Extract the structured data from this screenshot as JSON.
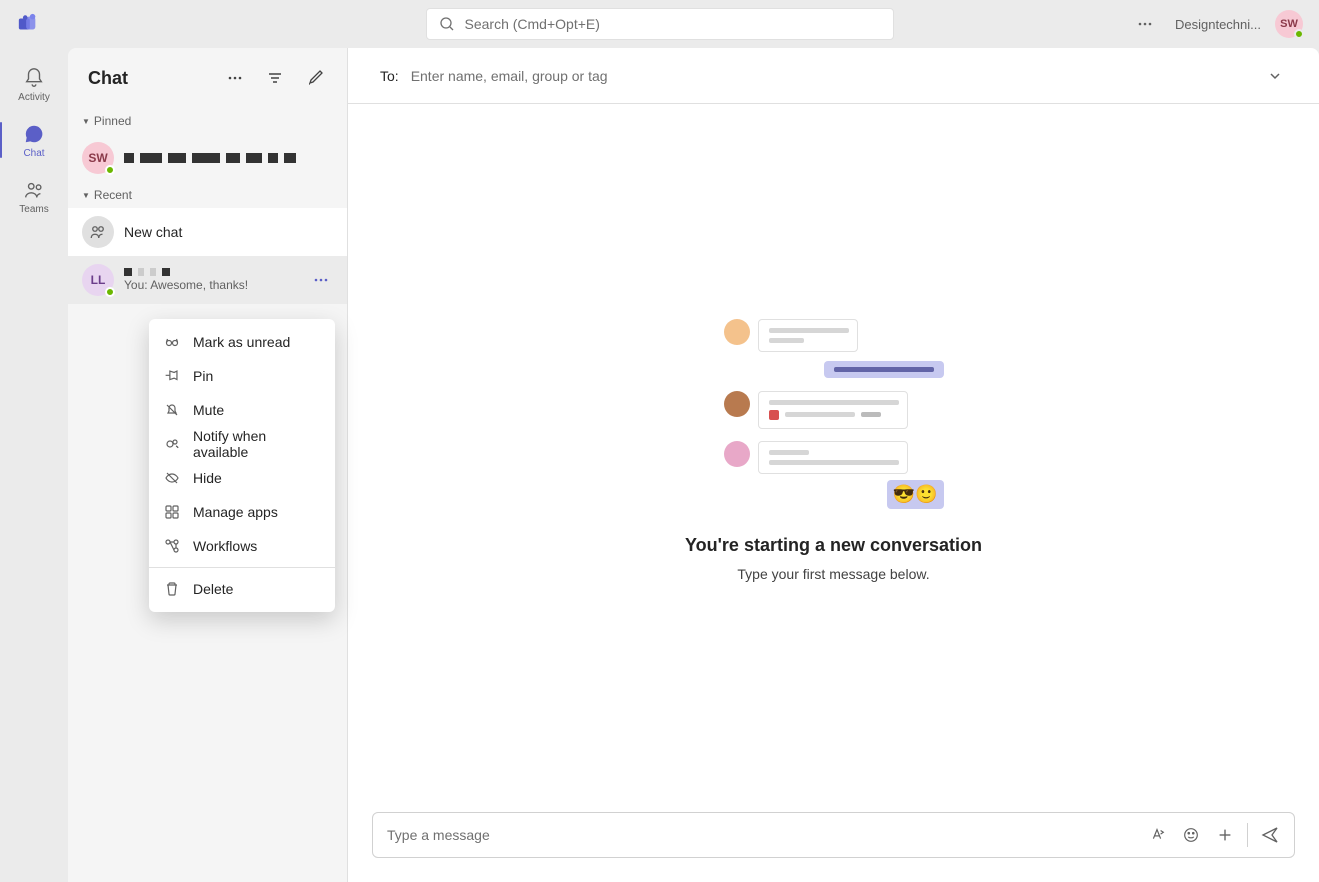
{
  "topbar": {
    "search_placeholder": "Search (Cmd+Opt+E)",
    "org_name": "Designtechni...",
    "avatar_initials": "SW"
  },
  "rail": {
    "activity": "Activity",
    "chat": "Chat",
    "teams": "Teams"
  },
  "chatPanel": {
    "title": "Chat",
    "pinned_label": "Pinned",
    "recent_label": "Recent",
    "pinned_items": [
      {
        "initials": "SW"
      }
    ],
    "recent_items": [
      {
        "title": "New chat",
        "type": "new"
      },
      {
        "initials": "LL",
        "preview": "You: Awesome, thanks!"
      }
    ]
  },
  "contextMenu": {
    "mark_unread": "Mark as unread",
    "pin": "Pin",
    "mute": "Mute",
    "notify": "Notify when available",
    "hide": "Hide",
    "manage_apps": "Manage apps",
    "workflows": "Workflows",
    "delete": "Delete"
  },
  "compose": {
    "to_label": "To:",
    "to_placeholder": "Enter name, email, group or tag"
  },
  "emptyState": {
    "title": "You're starting a new conversation",
    "subtitle": "Type your first message below."
  },
  "composer": {
    "placeholder": "Type a message"
  }
}
